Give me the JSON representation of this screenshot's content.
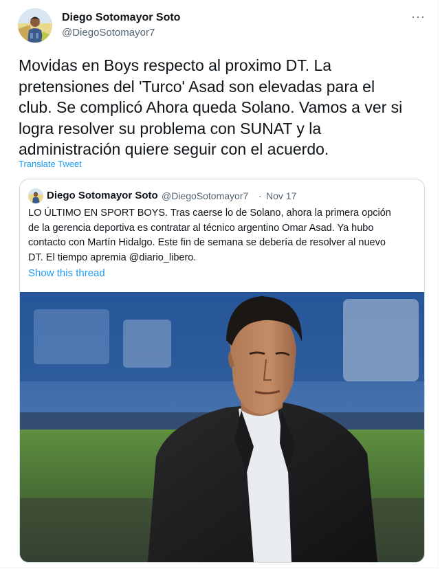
{
  "tweet": {
    "author_name": "Diego Sotomayor Soto",
    "author_handle": "@DiegoSotomayor7",
    "more_label": "···",
    "text": "Movidas en Boys respecto al proximo DT. La\npretensiones del 'Turco' Asad son elevadas para el\nclub. Se complicó  Ahora queda Solano. Vamos a ver si\nlogra resolver su problema con SUNAT y la\nadministración quiere seguir con el acuerdo.",
    "translate_label": "Translate Tweet"
  },
  "quoted_tweet": {
    "author_name": "Diego Sotomayor Soto",
    "author_handle": "@DiegoSotomayor7",
    "separator": "·",
    "date": "Nov 17",
    "text": "LO ÚLTIMO EN SPORT BOYS. Tras caerse lo de Solano, ahora la primera opción\nde la gerencia deportiva es contratar al técnico argentino Omar Asad. Ya hubo\ncontacto con Martín Hidalgo. Este fin de semana se debería de resolver al nuevo\nDT. El tiempo apremia @diario_libero.",
    "show_thread_label": "Show this thread"
  },
  "colors": {
    "link": "#1d9bf0",
    "secondary_text": "#536471",
    "border": "#cfd9de"
  }
}
